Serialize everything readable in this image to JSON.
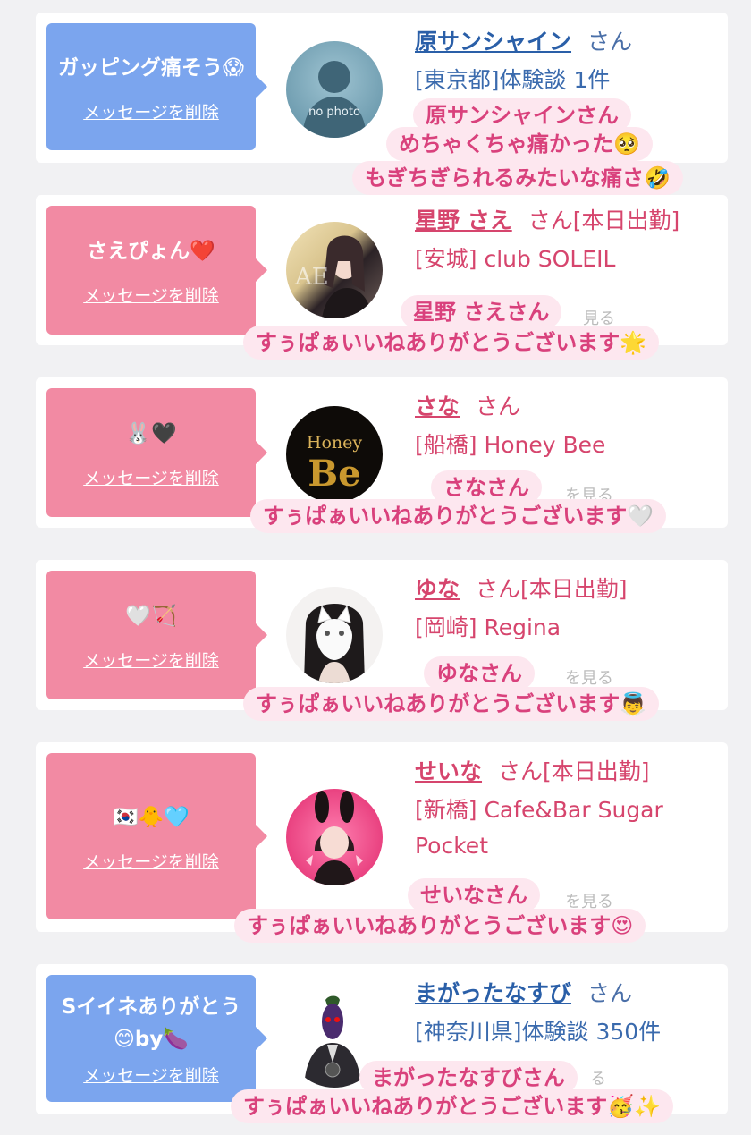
{
  "colors": {
    "bubble_blue": "#7ba5ee",
    "bubble_pink": "#f28aa3",
    "name_blue": "#2a5fa8",
    "name_pink": "#d6456d",
    "caption_bg": "#fde7ef",
    "caption_text": "#d9417c"
  },
  "cards": [
    {
      "theme": "blue",
      "message": "ガッピング痛そう😱",
      "delete_label": "メッセージを削除",
      "avatar": "no-photo-silhouette",
      "avatar_text": "no photo",
      "name": "原サンシャイン",
      "suffix": "さん",
      "shop": "[東京都]体験談 1件",
      "faded": "",
      "captions": [
        "原サンシャインさん",
        "めちゃくちゃ痛かった🥺",
        "もぎちぎられるみたいな痛さ🤣"
      ]
    },
    {
      "theme": "pink",
      "message": "さえぴょん❤️",
      "delete_label": "メッセージを削除",
      "avatar": "woman-photo",
      "name": "星野 さえ",
      "suffix": "さん[本日出勤]",
      "shop": "[安城] club SOLEIL",
      "faded": "見る",
      "captions": [
        "星野 さえさん",
        "すぅぱぁいいねありがとうございます🌟"
      ]
    },
    {
      "theme": "pink",
      "message": "🐰🖤",
      "delete_label": "メッセージを削除",
      "avatar": "honey-bee-logo",
      "avatar_text": "Honey",
      "avatar_text2": "Be",
      "name": "さな",
      "suffix": "さん",
      "shop": "[船橋] Honey Bee",
      "faded": "を見る",
      "captions": [
        "さなさん",
        "すぅぱぁいいねありがとうございます🤍"
      ]
    },
    {
      "theme": "pink",
      "message": "🤍🏹",
      "delete_label": "メッセージを削除",
      "avatar": "woman-cat-mask-photo",
      "name": "ゆな",
      "suffix": "さん[本日出勤]",
      "shop": "[岡崎] Regina",
      "faded": "を見る",
      "captions": [
        "ゆなさん",
        "すぅぱぁいいねありがとうございます👼"
      ]
    },
    {
      "theme": "pink",
      "message": "🇰🇷🐥🩵",
      "delete_label": "メッセージを削除",
      "avatar": "woman-bunny-ears-photo",
      "name": "せいな",
      "suffix": "さん[本日出勤]",
      "shop": "[新橋] Cafe&Bar Sugar Pocket",
      "faded": "を見る",
      "captions": [
        "せいなさん",
        "すぅぱぁいいねありがとうございます😍"
      ]
    },
    {
      "theme": "blue",
      "message": "Sイイネありがとう😊by🍆",
      "delete_label": "メッセージを削除",
      "avatar": "eggplant-character",
      "name": "まがったなすび",
      "suffix": "さん",
      "shop": "[神奈川県]体験談 350件",
      "faded": "る",
      "captions": [
        "まがったなすびさん",
        "すぅぱぁいいねありがとうございます🥳✨"
      ]
    }
  ]
}
